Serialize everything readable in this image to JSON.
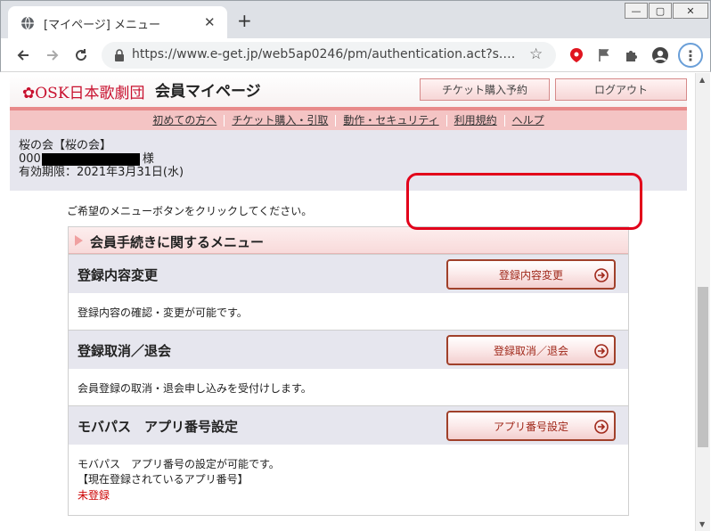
{
  "browser": {
    "tab_title": "[マイページ] メニュー",
    "new_tab": "+",
    "close": "✕",
    "url": "https://www.e-get.jp/web5ap0246/pm/authentication.act?s.…",
    "window_buttons": {
      "minimize": "—",
      "maximize": "▢",
      "close": "✕"
    }
  },
  "site": {
    "logo": "OSK日本歌劇団",
    "title": "会員マイページ",
    "buttons": {
      "ticket": "チケット購入予約",
      "logout": "ログアウト"
    },
    "nav": [
      "初めての方へ",
      "チケット購入・引取",
      "動作・セキュリティ",
      "利用規約",
      "ヘルプ"
    ]
  },
  "member": {
    "club": "桜の会【桜の会】",
    "id_prefix": "000",
    "honorific": "様",
    "expiry": "有効期限：2021年3月31日(水)"
  },
  "instruction": "ご希望のメニューボタンをクリックしてください。",
  "menu": {
    "section_title": "会員手続きに関するメニュー",
    "rows": [
      {
        "title": "登録内容変更",
        "button": "登録内容変更",
        "desc": "登録内容の確認・変更が可能です。"
      },
      {
        "title": "登録取消／退会",
        "button": "登録取消／退会",
        "desc": "会員登録の取消・退会申し込みを受付けします。"
      },
      {
        "title": "モバパス　アプリ番号設定",
        "button": "アプリ番号設定",
        "desc": "モバパス　アプリ番号の設定が可能です。",
        "note": "【現在登録されているアプリ番号】",
        "status": "未登録"
      }
    ]
  },
  "colors": {
    "accent": "#c8102e",
    "highlight": "#e2001a",
    "button_border": "#a0402a"
  }
}
